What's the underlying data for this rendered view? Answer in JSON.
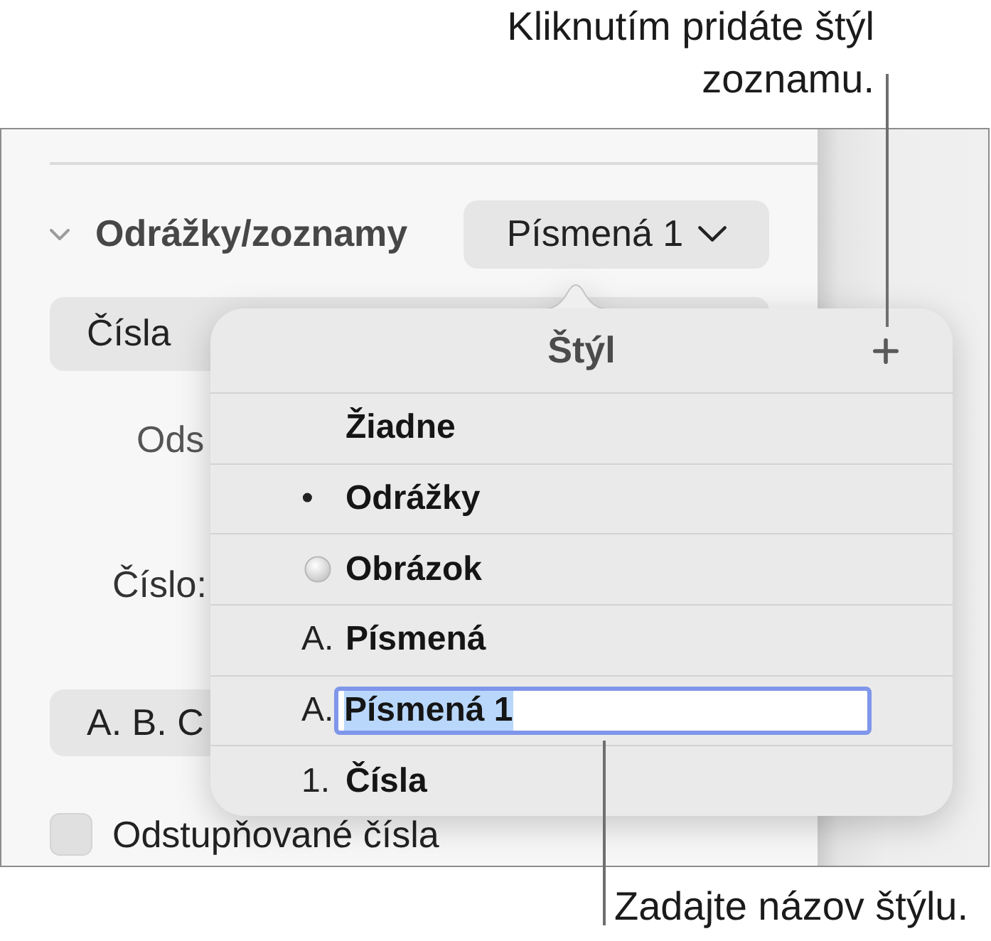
{
  "callouts": {
    "top": "Kliknutím pridáte štýl zoznamu.",
    "bottom": "Zadajte názov štýlu."
  },
  "panel": {
    "section": {
      "title": "Odrážky/zoznamy",
      "expanded": true,
      "style_popup": "Písmená 1"
    },
    "list_type_popup": "Čísla",
    "indent_label": "Ods",
    "number_label": "Číslo:",
    "number_format_popup": "A. B. C",
    "tiered_numbers": {
      "label": "Odstupňované čísla",
      "checked": false
    }
  },
  "popover": {
    "title": "Štýl",
    "items": [
      {
        "kind": "none",
        "label": "Žiadne",
        "editing": false,
        "text_selected": false
      },
      {
        "kind": "text",
        "marker": "•",
        "label": "Odrážky",
        "editing": false,
        "text_selected": false
      },
      {
        "kind": "image",
        "label": "Obrázok",
        "editing": false,
        "text_selected": false
      },
      {
        "kind": "text",
        "marker": "A.",
        "label": "Písmená",
        "editing": false,
        "text_selected": false
      },
      {
        "kind": "text",
        "marker": "A.",
        "label": "Písmená 1",
        "editing": true,
        "text_selected": true
      },
      {
        "kind": "text",
        "marker": "1.",
        "label": "Čísla",
        "editing": false,
        "text_selected": false
      }
    ]
  }
}
